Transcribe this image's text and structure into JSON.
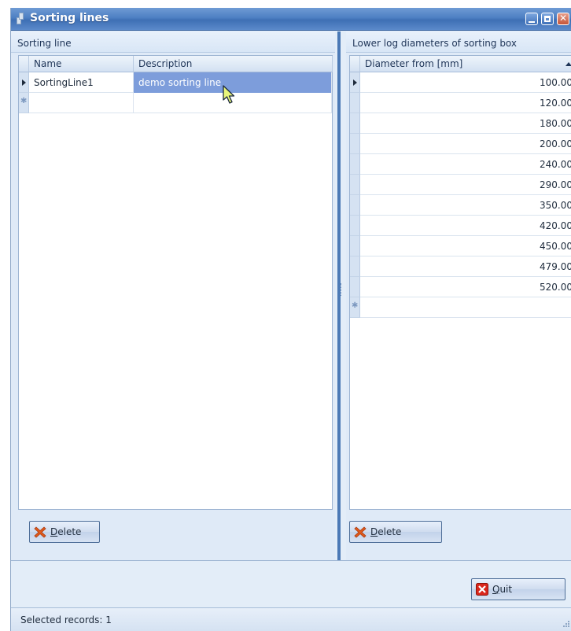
{
  "window": {
    "title": "Sorting lines"
  },
  "left_panel": {
    "caption": "Sorting line",
    "columns": [
      "Name",
      "Description"
    ],
    "rows": [
      {
        "name": "SortingLine1",
        "description": "demo sorting line"
      }
    ],
    "delete_button": {
      "underlined": "D",
      "rest": "elete"
    }
  },
  "right_panel": {
    "caption": "Lower log diameters of sorting box",
    "column": "Diameter from [mm]",
    "values": [
      "100.00",
      "120.00",
      "180.00",
      "200.00",
      "240.00",
      "290.00",
      "350.00",
      "420.00",
      "450.00",
      "479.00",
      "520.00"
    ],
    "delete_button": {
      "underlined": "D",
      "rest": "elete"
    }
  },
  "quit_button": {
    "underlined": "Q",
    "rest": "uit"
  },
  "status": {
    "text": "Selected records: 1"
  },
  "colors": {
    "title_bar": "#4d7fc3",
    "selection": "#7d9ddb",
    "splitter": "#4b79b6",
    "delete_icon": "#e05a1c",
    "quit_icon": "#d9261c"
  }
}
